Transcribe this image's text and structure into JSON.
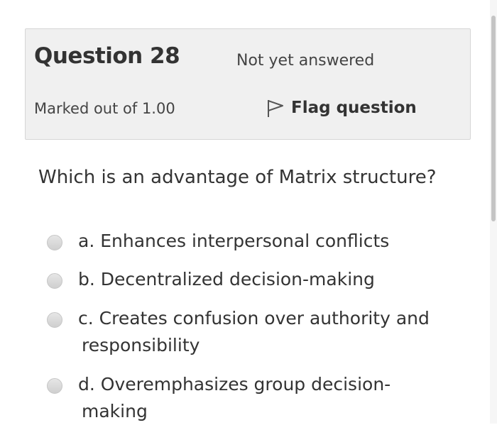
{
  "question": {
    "title": "Question 28",
    "state": "Not yet answered",
    "grade": "Marked out of 1.00",
    "flag_label": "Flag question",
    "text": "Which is an advantage of Matrix structure?"
  },
  "answers": [
    {
      "line1": "a. Enhances interpersonal conflicts",
      "line2": ""
    },
    {
      "line1": "b. Decentralized decision-making",
      "line2": ""
    },
    {
      "line1": "c. Creates confusion over authority and",
      "line2": "responsibility"
    },
    {
      "line1": "d. Overemphasizes group decision-",
      "line2": "making"
    }
  ],
  "icons": {
    "flag": "flag-outline-icon",
    "radio": "radio-unchecked"
  },
  "colors": {
    "info_background": "#f0f0f0",
    "text": "#333333",
    "radio": "#d8d8d8"
  }
}
